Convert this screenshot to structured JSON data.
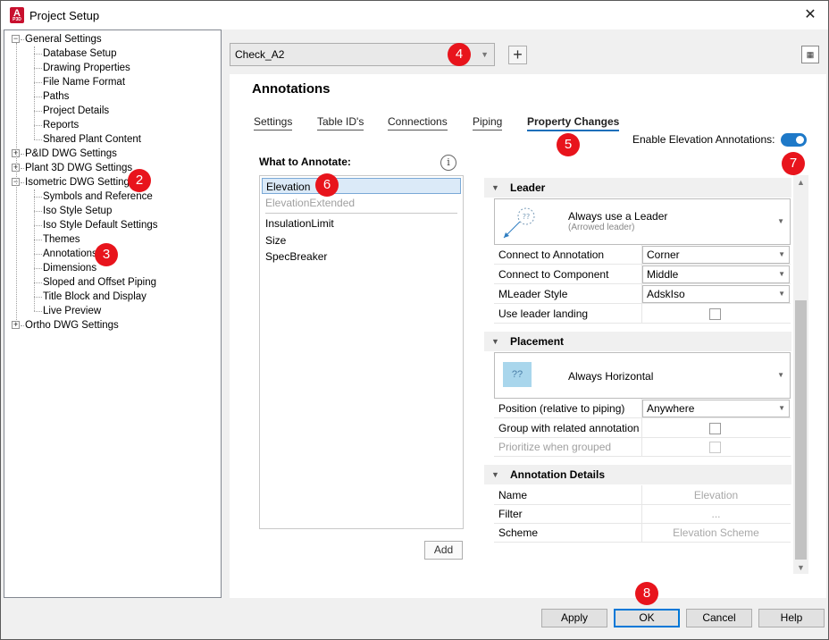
{
  "window": {
    "title": "Project Setup",
    "app_icon_letter": "A",
    "app_icon_sub": "P3D"
  },
  "tree": {
    "items": [
      {
        "label": "General Settings",
        "level": 0,
        "expander": "−"
      },
      {
        "label": "Database Setup",
        "level": 1
      },
      {
        "label": "Drawing Properties",
        "level": 1
      },
      {
        "label": "File Name Format",
        "level": 1
      },
      {
        "label": "Paths",
        "level": 1
      },
      {
        "label": "Project Details",
        "level": 1
      },
      {
        "label": "Reports",
        "level": 1
      },
      {
        "label": "Shared Plant Content",
        "level": 1
      },
      {
        "label": "P&ID DWG Settings",
        "level": 0,
        "expander": "+"
      },
      {
        "label": "Plant 3D DWG Settings",
        "level": 0,
        "expander": "+"
      },
      {
        "label": "Isometric DWG Settings",
        "level": 0,
        "expander": "−"
      },
      {
        "label": "Symbols and Reference",
        "level": 1
      },
      {
        "label": "Iso Style Setup",
        "level": 1
      },
      {
        "label": "Iso Style Default Settings",
        "level": 1
      },
      {
        "label": "Themes",
        "level": 1
      },
      {
        "label": "Annotations",
        "level": 1,
        "selected": true
      },
      {
        "label": "Dimensions",
        "level": 1
      },
      {
        "label": "Sloped and Offset Piping",
        "level": 1
      },
      {
        "label": "Title Block and Display",
        "level": 1
      },
      {
        "label": "Live Preview",
        "level": 1
      },
      {
        "label": "Ortho DWG Settings",
        "level": 0,
        "expander": "+"
      }
    ]
  },
  "config": {
    "selected": "Check_A2",
    "add_symbol": "+"
  },
  "section_title": "Annotations",
  "tabs": [
    "Settings",
    "Table ID's",
    "Connections",
    "Piping",
    "Property Changes"
  ],
  "active_tab": "Property Changes",
  "enable_elevation": {
    "label": "Enable Elevation Annotations:",
    "on": true
  },
  "what_to_annotate": {
    "label": "What to Annotate:",
    "items": [
      {
        "label": "Elevation",
        "state": "selected"
      },
      {
        "label": "ElevationExtended",
        "state": "disabled"
      },
      {
        "label": "InsulationLimit",
        "state": "normal"
      },
      {
        "label": "Size",
        "state": "normal"
      },
      {
        "label": "SpecBreaker",
        "state": "normal"
      }
    ],
    "add_button": "Add"
  },
  "properties": {
    "leader": {
      "title": "Leader",
      "preview": {
        "label": "Always use a Leader",
        "sub": "(Arrowed leader)",
        "glyph": "??"
      },
      "rows": [
        {
          "name": "Connect to Annotation",
          "value": "Corner",
          "type": "dropdown"
        },
        {
          "name": "Connect to Component",
          "value": "Middle",
          "type": "dropdown"
        },
        {
          "name": "MLeader Style",
          "value": "AdskIso",
          "type": "dropdown"
        },
        {
          "name": "Use leader landing",
          "type": "checkbox"
        }
      ]
    },
    "placement": {
      "title": "Placement",
      "preview": {
        "label": "Always Horizontal",
        "glyph": "??"
      },
      "rows": [
        {
          "name": "Position (relative to piping)",
          "value": "Anywhere",
          "type": "dropdown"
        },
        {
          "name": "Group with related annotations",
          "type": "checkbox"
        },
        {
          "name": "Prioritize when grouped",
          "type": "checkbox",
          "disabled": true
        }
      ]
    },
    "details": {
      "title": "Annotation Details",
      "rows": [
        {
          "name": "Name",
          "value": "Elevation"
        },
        {
          "name": "Filter",
          "value": "..."
        },
        {
          "name": "Scheme",
          "value": "Elevation Scheme"
        }
      ]
    }
  },
  "buttons": {
    "apply": "Apply",
    "ok": "OK",
    "cancel": "Cancel",
    "help": "Help"
  },
  "callouts": [
    "2",
    "3",
    "4",
    "5",
    "6",
    "7",
    "8"
  ],
  "colors": {
    "accent": "#1e79c8",
    "callout": "#e8141c",
    "selection": "#dbeaf8"
  }
}
